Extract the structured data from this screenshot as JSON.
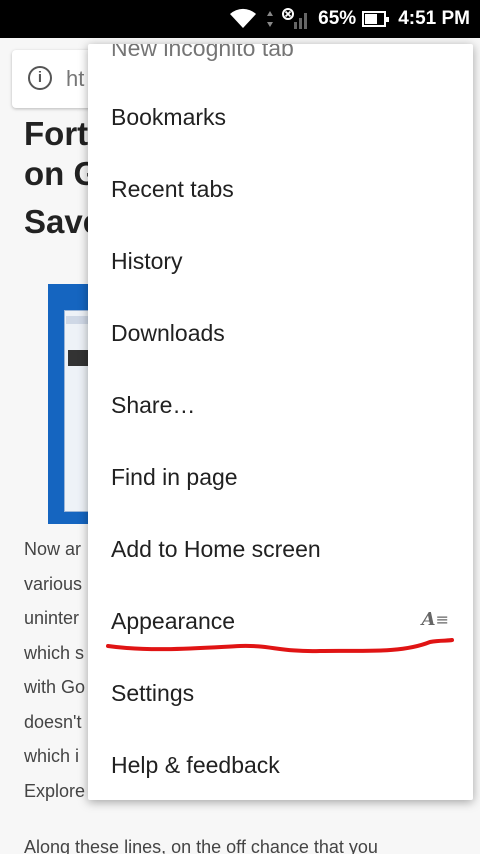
{
  "status_bar": {
    "battery_percent": "65%",
    "time": "4:51 PM",
    "battery_level": 0.65
  },
  "address_bar": {
    "url_fragment": "ht"
  },
  "article": {
    "headline_lines": [
      "Fort",
      "on G",
      "Save"
    ],
    "paragraph_lines": [
      "Now ar",
      "various",
      "uninter",
      "which s",
      "with Go",
      "doesn't",
      "which i",
      "Explore"
    ],
    "next_paragraph": "Along these lines, on the off chance that you"
  },
  "menu": {
    "items": [
      {
        "label": "New incognito tab"
      },
      {
        "label": "Bookmarks"
      },
      {
        "label": "Recent tabs"
      },
      {
        "label": "History"
      },
      {
        "label": "Downloads"
      },
      {
        "label": "Share…"
      },
      {
        "label": "Find in page"
      },
      {
        "label": "Add to Home screen"
      },
      {
        "label": "Appearance",
        "icon": "text-format-icon"
      },
      {
        "label": "Settings"
      },
      {
        "label": "Help & feedback"
      }
    ]
  },
  "colors": {
    "annotation_stroke": "#e01414",
    "hero_blue": "#1565c0"
  }
}
